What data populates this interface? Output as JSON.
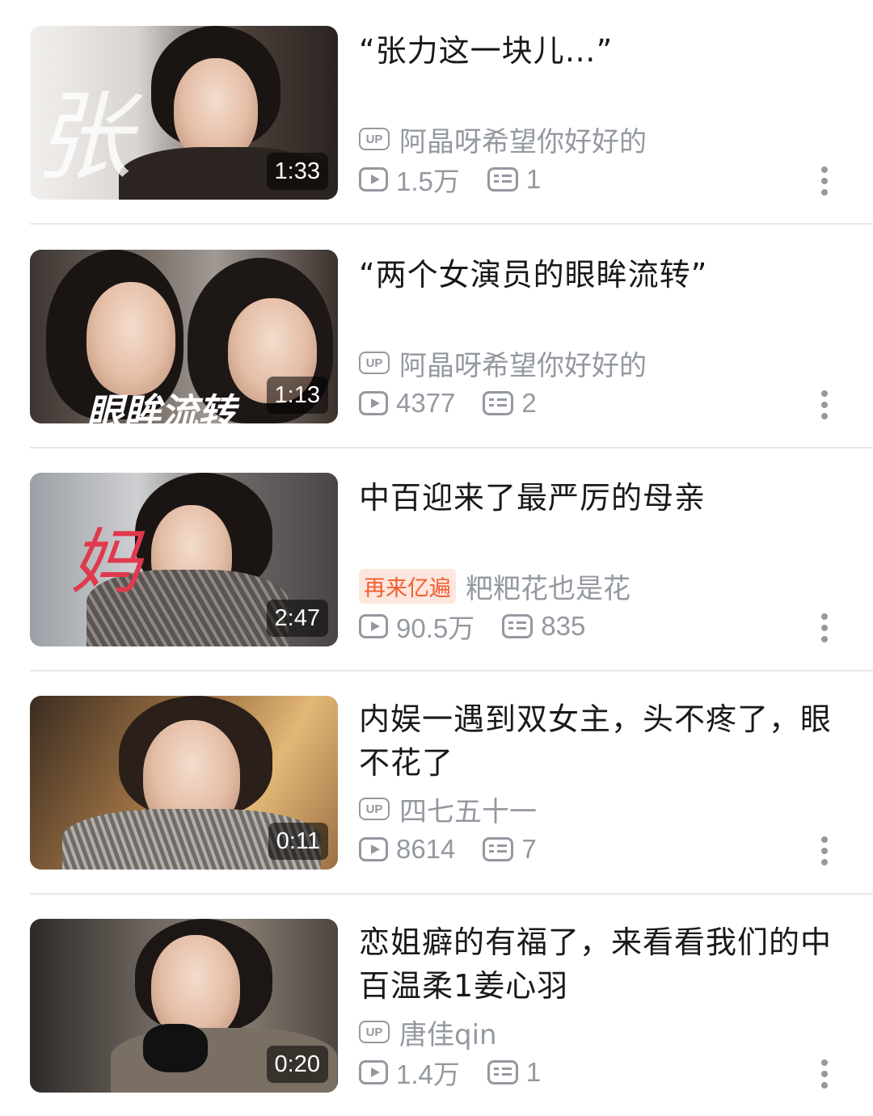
{
  "videos": [
    {
      "title": "“张力这一块儿…”",
      "duration": "1:33",
      "uploader_badge": "UP",
      "uploader_tag": "",
      "uploader": "阿晶呀希望你好好的",
      "views": "1.5万",
      "danmaku": "1",
      "overlay_text": "张 力"
    },
    {
      "title": "“两个女演员的眼眸流转”",
      "duration": "1:13",
      "uploader_badge": "UP",
      "uploader_tag": "",
      "uploader": "阿晶呀希望你好好的",
      "views": "4377",
      "danmaku": "2",
      "overlay_text": "眼眸流转"
    },
    {
      "title": "中百迎来了最严厉的母亲",
      "duration": "2:47",
      "uploader_badge": "",
      "uploader_tag": "再来亿遍",
      "uploader": "粑粑花也是花",
      "views": "90.5万",
      "danmaku": "835",
      "overlay_text": "妈 妈"
    },
    {
      "title": "内娱一遇到双女主，头不疼了，眼不花了",
      "duration": "0:11",
      "uploader_badge": "UP",
      "uploader_tag": "",
      "uploader": "四七五十一",
      "views": "8614",
      "danmaku": "7",
      "overlay_text": ""
    },
    {
      "title": "恋姐癖的有福了，来看看我们的中百温柔1姜心羽",
      "duration": "0:20",
      "uploader_badge": "UP",
      "uploader_tag": "",
      "uploader": "唐佳qin",
      "views": "1.4万",
      "danmaku": "1",
      "overlay_text": ""
    }
  ],
  "icons": {
    "play": "play-count-icon",
    "danmaku": "danmaku-count-icon",
    "more": "more-vertical-icon"
  },
  "colors": {
    "text_primary": "#18191c",
    "text_secondary": "#9499a0",
    "tag_text": "#f25d2e",
    "tag_bg": "#fde6de",
    "divider": "#e8e8ea"
  }
}
